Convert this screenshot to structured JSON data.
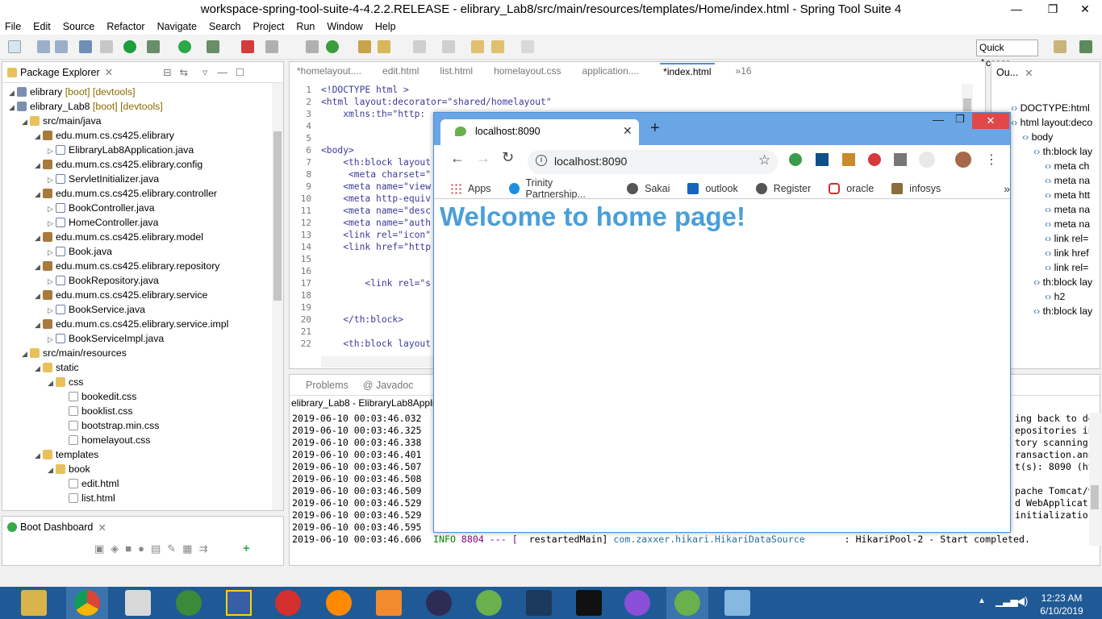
{
  "window": {
    "title": "workspace-spring-tool-suite-4-4.2.2.RELEASE - elibrary_Lab8/src/main/resources/templates/Home/index.html - Spring Tool Suite 4"
  },
  "menu": [
    "File",
    "Edit",
    "Source",
    "Refactor",
    "Navigate",
    "Search",
    "Project",
    "Run",
    "Window",
    "Help"
  ],
  "quick_access": "Quick Access",
  "package_explorer": {
    "title": "Package Explorer",
    "rows": [
      {
        "indent": 0,
        "icon": "proj",
        "label": "elibrary",
        "suffix": " [boot] [devtools]"
      },
      {
        "indent": 0,
        "icon": "proj",
        "label": "elibrary_Lab8",
        "suffix": " [boot] [devtools]"
      },
      {
        "indent": 1,
        "icon": "folder",
        "label": "src/main/java",
        "suffix": ""
      },
      {
        "indent": 2,
        "icon": "pkg",
        "label": "edu.mum.cs.cs425.elibrary",
        "suffix": ""
      },
      {
        "indent": 3,
        "icon": "java",
        "label": "ElibraryLab8Application.java",
        "suffix": ""
      },
      {
        "indent": 2,
        "icon": "pkg",
        "label": "edu.mum.cs.cs425.elibrary.config",
        "suffix": ""
      },
      {
        "indent": 3,
        "icon": "java",
        "label": "ServletInitializer.java",
        "suffix": ""
      },
      {
        "indent": 2,
        "icon": "pkg",
        "label": "edu.mum.cs.cs425.elibrary.controller",
        "suffix": ""
      },
      {
        "indent": 3,
        "icon": "java",
        "label": "BookController.java",
        "suffix": ""
      },
      {
        "indent": 3,
        "icon": "java",
        "label": "HomeController.java",
        "suffix": ""
      },
      {
        "indent": 2,
        "icon": "pkg",
        "label": "edu.mum.cs.cs425.elibrary.model",
        "suffix": ""
      },
      {
        "indent": 3,
        "icon": "java",
        "label": "Book.java",
        "suffix": ""
      },
      {
        "indent": 2,
        "icon": "pkg",
        "label": "edu.mum.cs.cs425.elibrary.repository",
        "suffix": ""
      },
      {
        "indent": 3,
        "icon": "java",
        "label": "BookRepository.java",
        "suffix": ""
      },
      {
        "indent": 2,
        "icon": "pkg",
        "label": "edu.mum.cs.cs425.elibrary.service",
        "suffix": ""
      },
      {
        "indent": 3,
        "icon": "java",
        "label": "BookService.java",
        "suffix": ""
      },
      {
        "indent": 2,
        "icon": "pkg",
        "label": "edu.mum.cs.cs425.elibrary.service.impl",
        "suffix": ""
      },
      {
        "indent": 3,
        "icon": "java",
        "label": "BookServiceImpl.java",
        "suffix": ""
      },
      {
        "indent": 1,
        "icon": "folder",
        "label": "src/main/resources",
        "suffix": ""
      },
      {
        "indent": 2,
        "icon": "folder",
        "label": "static",
        "suffix": ""
      },
      {
        "indent": 3,
        "icon": "folder",
        "label": "css",
        "suffix": ""
      },
      {
        "indent": 4,
        "icon": "file",
        "label": "bookedit.css",
        "suffix": ""
      },
      {
        "indent": 4,
        "icon": "file",
        "label": "booklist.css",
        "suffix": ""
      },
      {
        "indent": 4,
        "icon": "file",
        "label": "bootstrap.min.css",
        "suffix": ""
      },
      {
        "indent": 4,
        "icon": "file",
        "label": "homelayout.css",
        "suffix": ""
      },
      {
        "indent": 2,
        "icon": "folder",
        "label": "templates",
        "suffix": ""
      },
      {
        "indent": 3,
        "icon": "folder",
        "label": "book",
        "suffix": ""
      },
      {
        "indent": 4,
        "icon": "file",
        "label": "edit.html",
        "suffix": ""
      },
      {
        "indent": 4,
        "icon": "file",
        "label": "list.html",
        "suffix": ""
      }
    ]
  },
  "boot_dashboard": {
    "title": "Boot Dashboard"
  },
  "editor": {
    "tabs": [
      "*homelayout....",
      "edit.html",
      "list.html",
      "homelayout.css",
      "application....",
      "*index.html",
      "»16"
    ],
    "line_numbers": [
      "1",
      "2",
      "3",
      "4",
      "5",
      "6",
      "7",
      "8",
      "9",
      "10",
      "11",
      "12",
      "13",
      "14",
      "15",
      "16",
      "17",
      "18",
      "19",
      "20",
      "21",
      "22"
    ],
    "lines": [
      "<!DOCTYPE html >",
      "<html layout:decorator=\"shared/homelayout\"",
      "    xmlns:th=\"http:",
      "",
      "",
      "<body>",
      "    <th:block layout",
      "     <meta charset=\"",
      "    <meta name=\"view",
      "    <meta http-equiv",
      "    <meta name=\"desc",
      "    <meta name=\"auth",
      "    <link rel=\"icon\"",
      "    <link href=\"http",
      "",
      "",
      "        <link rel=\"s",
      "",
      "",
      "    </th:block>",
      "",
      "    <th:block layout"
    ]
  },
  "outline": {
    "title": "Ou...",
    "rows": [
      "DOCTYPE:html",
      "html layout:deco",
      "body",
      "th:block lay",
      "meta ch",
      "meta na",
      "meta htt",
      "meta na",
      "meta na",
      "link rel=",
      "link href",
      "link rel=",
      "th:block lay",
      "h2",
      "th:block lay"
    ]
  },
  "console": {
    "tabs": [
      "Problems",
      "@ Javadoc"
    ],
    "header": "elibrary_Lab8 - ElibraryLab8Applic",
    "lines": [
      "2019-06-10 00:03:46.032",
      "2019-06-10 00:03:46.325",
      "2019-06-10 00:03:46.338",
      "2019-06-10 00:03:46.401",
      "2019-06-10 00:03:46.507",
      "2019-06-10 00:03:46.508",
      "2019-06-10 00:03:46.509",
      "2019-06-10 00:03:46.529",
      "2019-06-10 00:03:46.529",
      "2019-06-10 00:03:46.595",
      "2019-06-10 00:03:46.606"
    ],
    "last_line_rest": {
      "level": "INFO",
      "pid": "8804 --- [",
      "thread": "restartedMain]",
      "logger": "com.zaxxer.hikari.HikariDataSource",
      "message": ": HikariPool-2 - Start completed."
    },
    "right_text": [
      "ing back to de",
      "epositories in",
      "tory scanning",
      "ransaction.ann",
      "t(s): 8090 (ht",
      "",
      "pache Tomcat/9",
      "d WebApplicati",
      "initializatio"
    ]
  },
  "chrome": {
    "tab_title": "localhost:8090",
    "url": "localhost:8090",
    "bookmarks": [
      "Apps",
      "Trinity Partnership...",
      "Sakai",
      "outlook",
      "Register",
      "oracle",
      "infosys"
    ],
    "page_heading": "Welcome to home page!"
  },
  "taskbar": {
    "time": "12:23 AM",
    "date": "6/10/2019"
  },
  "colors": {
    "chrome_frame": "#6aa5e6",
    "heading": "#4a9fd9",
    "taskbar": "#1f5a96"
  }
}
